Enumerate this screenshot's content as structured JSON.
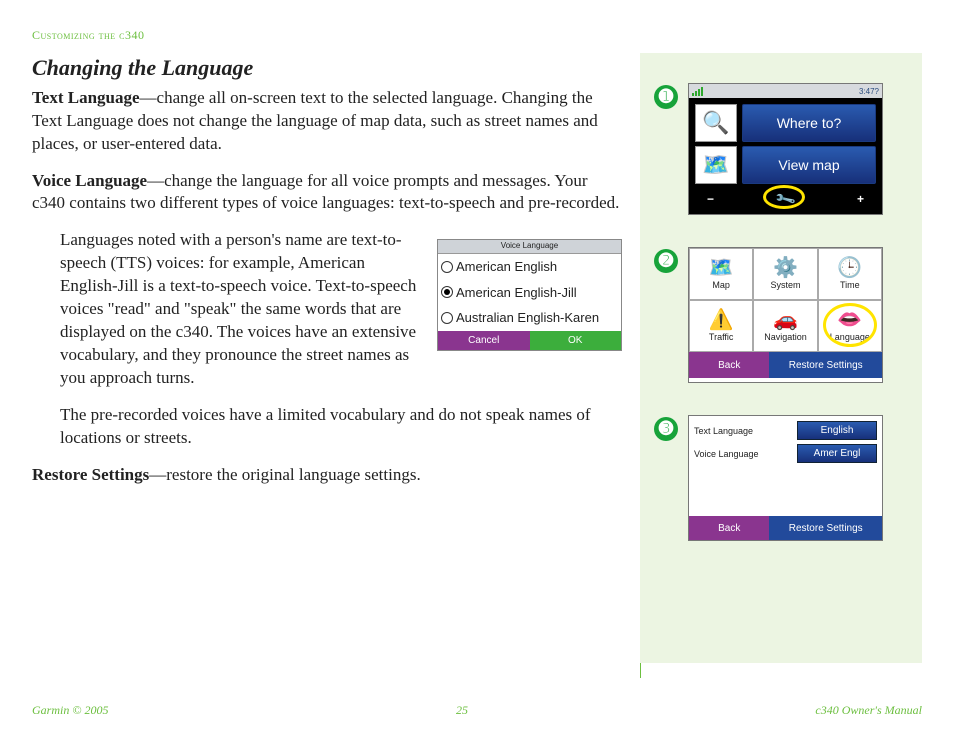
{
  "header": {
    "breadcrumb": "Customizing the c340"
  },
  "title": "Changing the Language",
  "para_text_lang_label": "Text Language",
  "para_text_lang_body": "—change all on-screen text to the selected language. Changing the Text Language does not change the language of map data, such as street names and places, or user-entered data.",
  "para_voice_lang_label": "Voice Language",
  "para_voice_lang_body": "—change the language for all voice prompts and messages. Your c340 contains two different types of voice languages: text-to-speech and pre-recorded.",
  "tts_para": "Languages noted with a person's name are text-to-speech (TTS) voices: for example, American English-Jill is a text-to-speech voice. Text-to-speech voices \"read\" and \"speak\" the same words that are displayed on the c340. The voices have an extensive vocabulary, and they pronounce the street names as you approach turns.",
  "prerecorded_para": "The pre-recorded voices have a limited vocabulary and do not speak names of locations or streets.",
  "restore_label": "Restore Settings",
  "restore_body": "—restore the original language settings.",
  "voice_popup": {
    "title": "Voice Language",
    "opts": [
      "American English",
      "American English-Jill",
      "Australian English-Karen"
    ],
    "selected_index": 1,
    "cancel": "Cancel",
    "ok": "OK"
  },
  "steps": {
    "s1": {
      "time": "3:47?",
      "where_to": "Where to?",
      "view_map": "View map"
    },
    "s2": {
      "cells": [
        "Map",
        "System",
        "Time",
        "Traffic",
        "Navigation",
        "Language"
      ],
      "back": "Back",
      "restore": "Restore Settings"
    },
    "s3": {
      "row1_label": "Text Language",
      "row1_value": "English",
      "row2_label": "Voice Language",
      "row2_value": "Amer Engl",
      "back": "Back",
      "restore": "Restore Settings"
    }
  },
  "footer": {
    "left": "Garmin © 2005",
    "center": "25",
    "right": "c340 Owner's Manual"
  }
}
